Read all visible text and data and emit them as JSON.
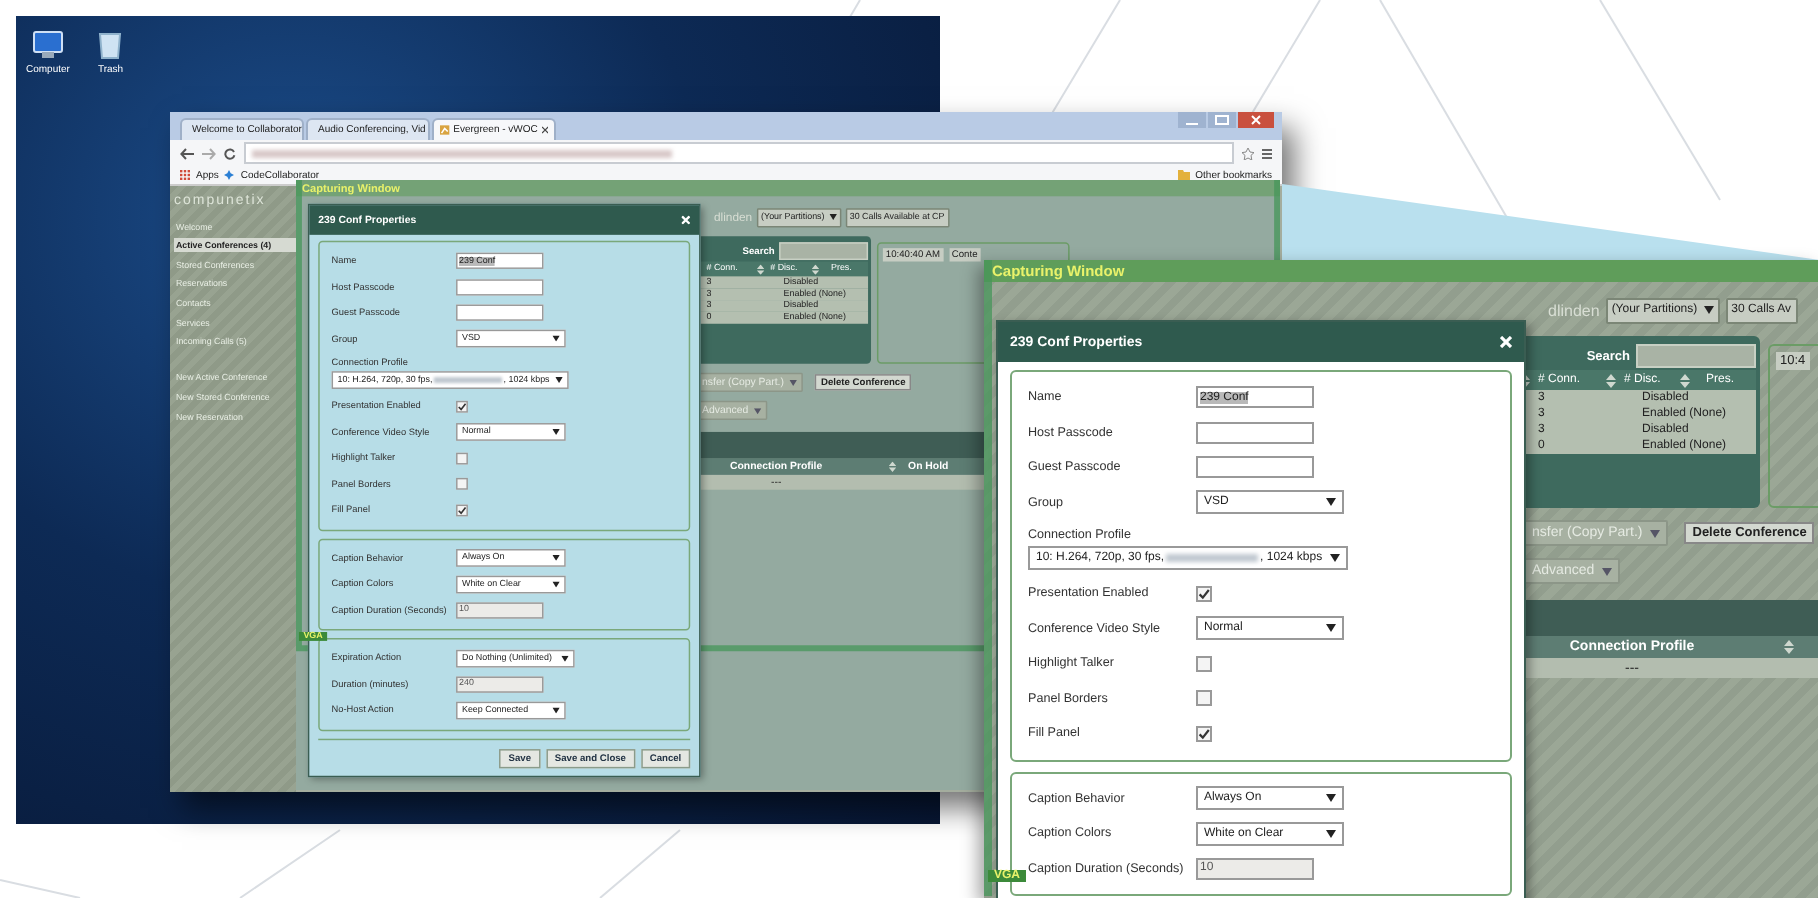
{
  "desktop": {
    "icons": [
      {
        "label": "Computer",
        "kind": "computer"
      },
      {
        "label": "Trash",
        "kind": "trash"
      }
    ]
  },
  "browser": {
    "tabs": [
      {
        "label": "Welcome to Collaborator",
        "selected": false,
        "kind": "star"
      },
      {
        "label": "Audio Conferencing, Vid",
        "selected": false,
        "kind": "circle"
      },
      {
        "label": "Evergreen - vWOC",
        "selected": true,
        "kind": "chart"
      }
    ],
    "bookmarks": [
      "Apps",
      "CodeCollaborator"
    ],
    "other_bookmarks": "Other bookmarks",
    "logo": "compunetix",
    "sidebar": [
      {
        "label": "Welcome",
        "selected": false
      },
      {
        "label": "Active Conferences (4)",
        "selected": true
      },
      {
        "label": "Stored Conferences",
        "selected": false
      },
      {
        "label": "Reservations",
        "selected": false
      },
      {
        "label": "Contacts",
        "selected": false
      },
      {
        "label": "Services",
        "selected": false
      },
      {
        "label": "Incoming Calls (5)",
        "selected": false
      }
    ],
    "sidebar_links": [
      "New Active Conference",
      "New Stored Conference",
      "New Reservation"
    ],
    "app_view": {
      "capture_label": "Capturing Window",
      "vga_label": "VGA",
      "user": "dlinden",
      "partitions": "(Your Partitions)",
      "calls": "30 Calls Available at CP",
      "search_label": "Search",
      "columns": [
        "# Conn.",
        "# Disc.",
        "Pres."
      ],
      "rows": [
        [
          "3",
          "Disabled"
        ],
        [
          "3",
          "Enabled (None)"
        ],
        [
          "3",
          "Disabled"
        ],
        [
          "0",
          "Enabled (None)"
        ]
      ],
      "time_tabs": [
        "10:40:40 AM",
        "Conte"
      ],
      "transfer": "nsfer (Copy Part.)",
      "delete": "Delete Conference",
      "advanced": "Advanced",
      "lower_columns": [
        "Connection Profile",
        "On Hold"
      ],
      "lower_row": "---",
      "dialog": {
        "title": "239 Conf Properties",
        "sections": [
          {
            "rows": [
              {
                "kind": "text",
                "label": "Name",
                "value": "239 Conf"
              },
              {
                "kind": "text",
                "label": "Host Passcode"
              },
              {
                "kind": "text",
                "label": "Guest Passcode"
              },
              {
                "kind": "select",
                "label": "Group",
                "value": "VSD"
              },
              {
                "kind": "wide",
                "label": "Connection Profile",
                "value": "10: H.264, 720p, 30 fps,",
                "value_end": ", 1024 kbps"
              },
              {
                "kind": "checkbox",
                "label": "Presentation Enabled",
                "checked": true
              },
              {
                "kind": "select",
                "label": "Conference Video Style",
                "value": "Normal"
              },
              {
                "kind": "checkbox",
                "label": "Highlight Talker",
                "checked": false
              },
              {
                "kind": "checkbox",
                "label": "Panel Borders",
                "checked": false
              },
              {
                "kind": "checkbox",
                "label": "Fill Panel",
                "checked": true
              }
            ]
          },
          {
            "rows": [
              {
                "kind": "select",
                "label": "Caption Behavior",
                "value": "Always On"
              },
              {
                "kind": "select",
                "label": "Caption Colors",
                "value": "White on Clear"
              },
              {
                "kind": "readonly",
                "label": "Caption Duration (Seconds)",
                "value": "10"
              }
            ]
          },
          {
            "rows": [
              {
                "kind": "select",
                "label": "Expiration Action",
                "value": "Do Nothing (Unlimited)"
              },
              {
                "kind": "readonly",
                "label": "Duration (minutes)",
                "value": "240"
              },
              {
                "kind": "select",
                "label": "No-Host Action",
                "value": "Keep Connected"
              }
            ]
          }
        ],
        "buttons": [
          "Save",
          "Save and Close",
          "Cancel"
        ]
      }
    }
  },
  "callout": {
    "app_view": {
      "capture_label": "Capturing Window",
      "vga_label": "VGA",
      "user": "dlinden",
      "partitions": "(Your Partitions)",
      "calls": "30 Calls Av",
      "search_label": "Search",
      "columns": [
        "# Conn.",
        "# Disc.",
        "Pres."
      ],
      "rows": [
        [
          "3",
          "Disabled"
        ],
        [
          "3",
          "Enabled (None)"
        ],
        [
          "3",
          "Disabled"
        ],
        [
          "0",
          "Enabled (None)"
        ]
      ],
      "time_tabs": [
        "10:4"
      ],
      "transfer": "nsfer (Copy Part.)",
      "delete": "Delete Conference",
      "advanced": "Advanced",
      "lower_columns": [
        "Connection Profile"
      ],
      "lower_row": "---",
      "dialog": {
        "title": "239 Conf Properties",
        "sections": [
          {
            "rows": [
              {
                "kind": "text",
                "label": "Name",
                "value": "239 Conf"
              },
              {
                "kind": "text",
                "label": "Host Passcode"
              },
              {
                "kind": "text",
                "label": "Guest Passcode"
              },
              {
                "kind": "select",
                "label": "Group",
                "value": "VSD"
              },
              {
                "kind": "wide",
                "label": "Connection Profile",
                "value": "10: H.264, 720p, 30 fps,",
                "value_end": ", 1024 kbps"
              },
              {
                "kind": "checkbox",
                "label": "Presentation Enabled",
                "checked": true
              },
              {
                "kind": "select",
                "label": "Conference Video Style",
                "value": "Normal"
              },
              {
                "kind": "checkbox",
                "label": "Highlight Talker",
                "checked": false
              },
              {
                "kind": "checkbox",
                "label": "Panel Borders",
                "checked": false
              },
              {
                "kind": "checkbox",
                "label": "Fill Panel",
                "checked": true
              }
            ]
          },
          {
            "rows": [
              {
                "kind": "select",
                "label": "Caption Behavior",
                "value": "Always On"
              },
              {
                "kind": "select",
                "label": "Caption Colors",
                "value": "White on Clear"
              },
              {
                "kind": "readonly",
                "label": "Caption Duration (Seconds)",
                "value": "10"
              }
            ]
          }
        ]
      }
    }
  }
}
